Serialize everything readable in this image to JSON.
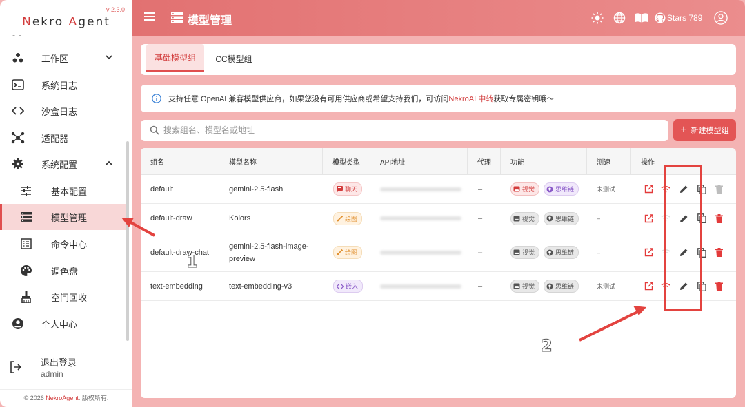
{
  "app": {
    "version": "v 2.3.0",
    "logo_part1": "N",
    "logo_part2": "ekro ",
    "logo_part3": "A",
    "logo_part4": "gent"
  },
  "sidebar": {
    "collapsed_marker": "- -",
    "items": [
      {
        "label": "工作区",
        "icon": "workspace-icon",
        "chevron": "▾"
      },
      {
        "label": "系统日志",
        "icon": "terminal-icon"
      },
      {
        "label": "沙盒日志",
        "icon": "code-icon"
      },
      {
        "label": "适配器",
        "icon": "hub-icon"
      },
      {
        "label": "系统配置",
        "icon": "gear-icon",
        "chevron": "▴"
      },
      {
        "label": "基本配置",
        "icon": "sliders-icon"
      },
      {
        "label": "模型管理",
        "icon": "list-icon"
      },
      {
        "label": "命令中心",
        "icon": "command-list-icon"
      },
      {
        "label": "调色盘",
        "icon": "palette-icon"
      },
      {
        "label": "空间回收",
        "icon": "broom-icon"
      },
      {
        "label": "个人中心",
        "icon": "user-circle-icon"
      }
    ],
    "logout_label": "退出登录",
    "username": "admin",
    "footer_prefix": "© 2026 ",
    "footer_brand": "NekroAgent",
    "footer_suffix": ". 版权所有."
  },
  "header": {
    "title": "模型管理",
    "stars_label": "Stars 789"
  },
  "tabs": [
    {
      "label": "基础模型组"
    },
    {
      "label": "CC模型组"
    }
  ],
  "info": {
    "text_before": "支持任意 OpenAI 兼容模型供应商，如果您没有可用供应商或希望支持我们，可访问 ",
    "link": "NekroAI 中转",
    "text_after": " 获取专属密钥哦～"
  },
  "search": {
    "placeholder": "搜索组名、模型名或地址"
  },
  "new_button": {
    "label": "新建模型组",
    "icon": "+"
  },
  "table": {
    "headers": [
      "组名",
      "模型名称",
      "模型类型",
      "API地址",
      "代理",
      "功能",
      "测速",
      "操作"
    ],
    "rows": [
      {
        "name": "default",
        "model": "gemini-2.5-flash",
        "type": "聊天",
        "type_kind": "chat",
        "proxy": "–",
        "vision": "视觉",
        "vision_on": true,
        "cot": "思维链",
        "cot_on": true,
        "speed": "未测试",
        "deletable": false
      },
      {
        "name": "default-draw",
        "model": "Kolors",
        "type": "绘图",
        "type_kind": "draw",
        "proxy": "–",
        "vision": "视觉",
        "vision_on": false,
        "cot": "思维链",
        "cot_on": false,
        "speed": "–",
        "deletable": true
      },
      {
        "name": "default-draw-chat",
        "model": "gemini-2.5-flash-image-preview",
        "type": "绘图",
        "type_kind": "draw",
        "proxy": "–",
        "vision": "视觉",
        "vision_on": false,
        "cot": "思维链",
        "cot_on": false,
        "speed": "–",
        "deletable": true
      },
      {
        "name": "text-embedding",
        "model": "text-embedding-v3",
        "type": "嵌入",
        "type_kind": "embed",
        "proxy": "–",
        "vision": "视觉",
        "vision_on": false,
        "cot": "思维链",
        "cot_on": false,
        "speed": "未测试",
        "deletable": true
      }
    ]
  },
  "annotations": {
    "step1": "1",
    "step2": "2"
  },
  "colors": {
    "accent": "#e35555",
    "header_start": "#e27171",
    "background": "#f4b3b3",
    "annotation": "#e3433f"
  }
}
